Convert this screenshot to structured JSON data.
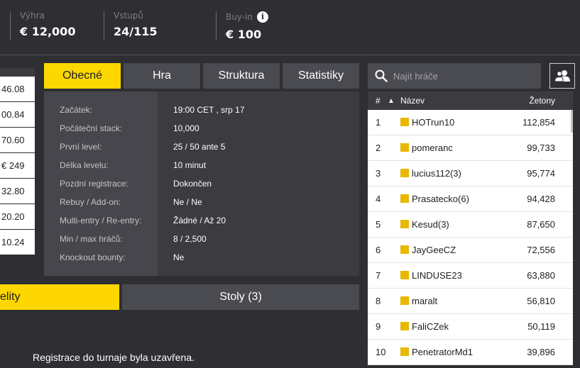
{
  "stats": [
    {
      "label": "Výhra",
      "value": "€ 12,000"
    },
    {
      "label": "Vstupů",
      "value": "24/115"
    },
    {
      "label": "Buy-in",
      "value": "€ 100"
    }
  ],
  "left_column": [
    "46.08",
    "00.84",
    "70.60",
    "€ 249",
    "32.80",
    "20.20",
    "10.24"
  ],
  "tabs": [
    "Obecné",
    "Hra",
    "Struktura",
    "Statistiky"
  ],
  "info": [
    {
      "label": "Začátek:",
      "value": "19:00 CET , srp 17"
    },
    {
      "label": "Počáteční stack:",
      "value": "10,000"
    },
    {
      "label": "První level:",
      "value": "25 / 50 ante 5"
    },
    {
      "label": "Délka levelu:",
      "value": "10 minut"
    },
    {
      "label": "Pozdní registrace:",
      "value": "Dokončen"
    },
    {
      "label": "Rebuy / Add-on:",
      "value": "Ne / Ne"
    },
    {
      "label": "Multi-entry / Re-entry:",
      "value": "Žádné / Až 20"
    },
    {
      "label": "Min / max hráčů:",
      "value": "8 / 2,500"
    },
    {
      "label": "Knockout bounty:",
      "value": "Ne"
    }
  ],
  "bottom_tabs": [
    "elity",
    "Stoly (3)"
  ],
  "registration_message": "Registrace do turnaje byla uzavřena.",
  "search": {
    "placeholder": "Najít hráče"
  },
  "players_table": {
    "headers": {
      "rank": "#",
      "sort": "▲",
      "name": "Název",
      "chips": "Žetony"
    },
    "rows": [
      {
        "rank": "1",
        "name": "HOTrun10",
        "chips": "112,854"
      },
      {
        "rank": "2",
        "name": "pomeranc",
        "chips": "99,733"
      },
      {
        "rank": "3",
        "name": "lucius112(3)",
        "chips": "95,774"
      },
      {
        "rank": "4",
        "name": "Prasatecko(6)",
        "chips": "94,428"
      },
      {
        "rank": "5",
        "name": "Kesud(3)",
        "chips": "87,650"
      },
      {
        "rank": "6",
        "name": "JayGeeCZ",
        "chips": "72,556"
      },
      {
        "rank": "7",
        "name": "LINDUSE23",
        "chips": "63,880"
      },
      {
        "rank": "8",
        "name": "maralt",
        "chips": "56,810"
      },
      {
        "rank": "9",
        "name": "FaliCZek",
        "chips": "50,119"
      },
      {
        "rank": "10",
        "name": "PenetratorMd1",
        "chips": "39,896"
      }
    ]
  },
  "colors": {
    "accent": "#fed700",
    "background": "#2e2e33",
    "tab": "#4a4a51",
    "player_marker": "#e8b800"
  },
  "icons": {
    "info": "info-icon",
    "search": "search-icon",
    "players": "players-icon"
  }
}
